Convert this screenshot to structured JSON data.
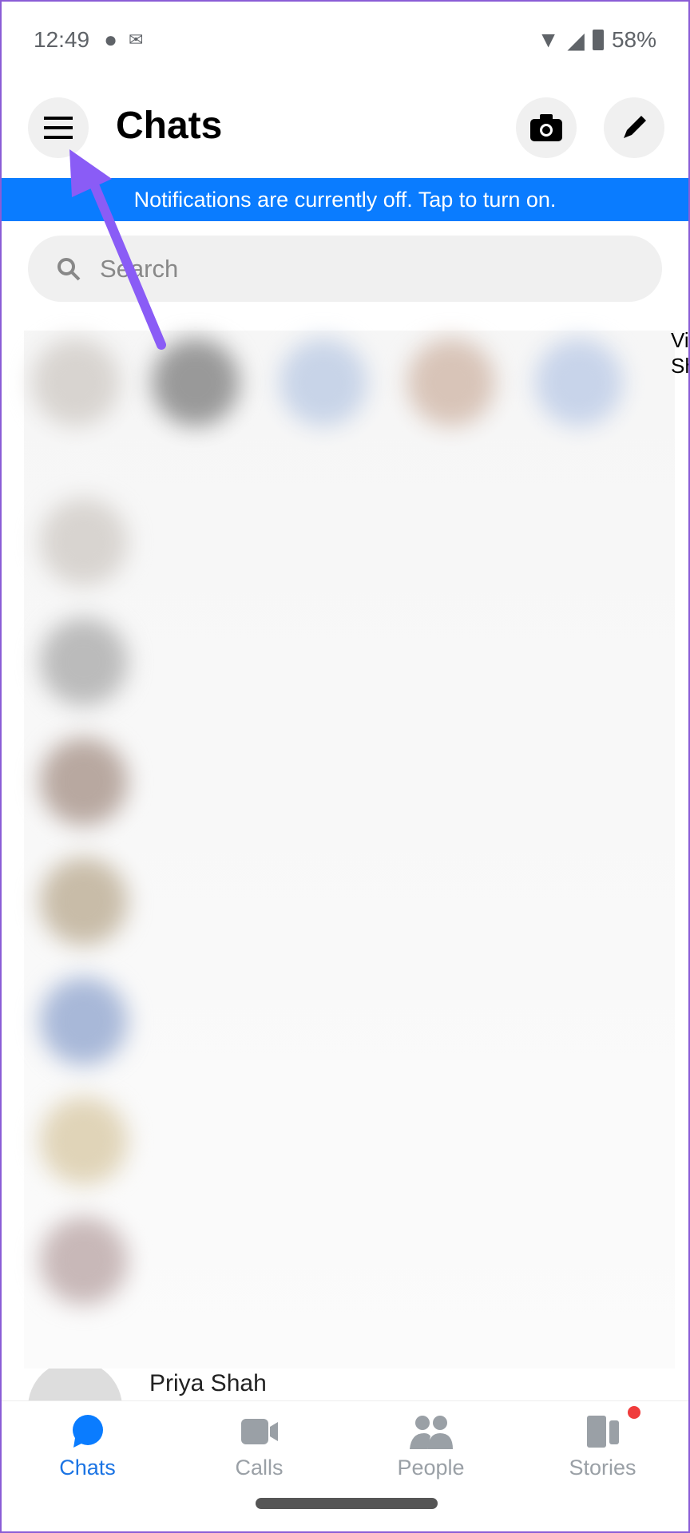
{
  "status": {
    "time": "12:49",
    "battery": "58%"
  },
  "header": {
    "title": "Chats"
  },
  "banner": {
    "text": "Notifications are currently off. Tap to turn on."
  },
  "search": {
    "placeholder": "Search"
  },
  "stories_partial": {
    "text": "Vi Sh"
  },
  "chat_partial": {
    "name": "Priya Shah"
  },
  "nav": {
    "tabs": [
      {
        "label": "Chats",
        "active": true
      },
      {
        "label": "Calls"
      },
      {
        "label": "People"
      },
      {
        "label": "Stories",
        "badge": true
      }
    ]
  },
  "colors": {
    "accent": "#0a7cff",
    "annotation_arrow": "#8a5cf6",
    "badge": "#f03c3c"
  }
}
